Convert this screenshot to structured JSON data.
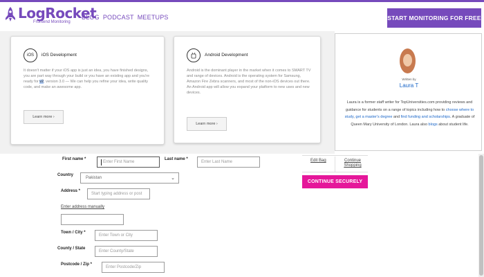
{
  "header": {
    "logo_name": "LogRocket",
    "logo_tag": "Frontend Monitoring",
    "nav": [
      "BLOG",
      "PODCAST",
      "MEETUPS"
    ],
    "cta": "START MONITORING FOR FREE",
    "accent_color": "#764abc"
  },
  "cards": [
    {
      "icon": "apple-icon",
      "title": "iOS Development",
      "text_before": "It doesn't matter if your iOS app is just an idea, you have finished designs, you are part way through your build or you have an existing app and you're ready for",
      "text_highlight": "v2",
      "text_after": ", version 3.0 — We can help you refine your idea, write quality code, and make an awesome app.",
      "button": "Learn more ›"
    },
    {
      "icon": "android-icon",
      "title": "Android Development",
      "text": "Android is the dominant player in the market when it comes to SMART TV and range of devices. Android is the operating system for Samsung, Amazon Fire Zebra scanners, and most of the non-iOS devices out there.\nAn Android app will allow you expand your platform to new uses and new devices.",
      "button": "Learn more ›"
    }
  ],
  "author": {
    "written_by": "Written by",
    "name": "Laura T",
    "bio_parts": [
      {
        "t": "Laura is a former staff writer for TopUniversities.com providing reviews and guidance for students on a range of topics including how to ",
        "link": false
      },
      {
        "t": "choose where to study",
        "link": true
      },
      {
        "t": ", ",
        "link": false
      },
      {
        "t": "get a master's degree",
        "link": true
      },
      {
        "t": " and ",
        "link": false
      },
      {
        "t": "find funding and scholarships",
        "link": true
      },
      {
        "t": ". A graduate of Queen Mary University of London. Laura also ",
        "link": false
      },
      {
        "t": "blogs",
        "link": true
      },
      {
        "t": " about student life.",
        "link": false
      }
    ]
  },
  "form": {
    "first_name_label": "First name *",
    "first_name_placeholder": "Enter First Name",
    "last_name_label": "Last name *",
    "last_name_placeholder": "Enter Last Name",
    "country_label": "Country",
    "country_value": "Pakistan",
    "address_label": "Address *",
    "address_placeholder": "Start typing address or post",
    "manual_link": "Enter address manually",
    "town_label": "Town / City *",
    "town_placeholder": "Enter Town or City",
    "county_label": "County / State",
    "county_placeholder": "Enter County/State",
    "postcode_label": "Postcode / Zip *",
    "postcode_placeholder": "Enter Postcode/Zip"
  },
  "bag": {
    "edit": "Edit Bag",
    "continue_shopping": "Continue Shopping",
    "checkout": "CONTINUE SECURELY",
    "checkout_color": "#e5179a"
  }
}
